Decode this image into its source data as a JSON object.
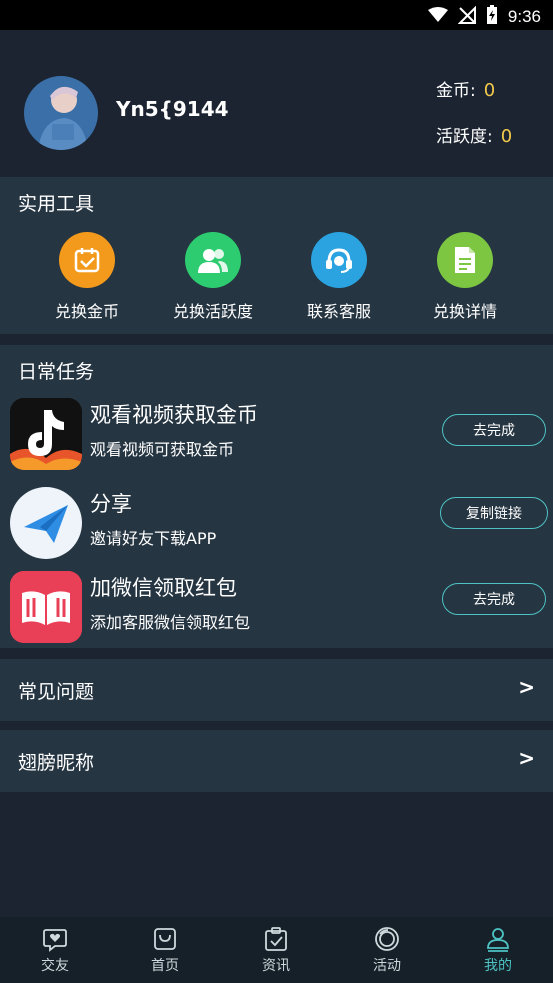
{
  "status_bar": {
    "time": "9:36"
  },
  "profile": {
    "username": "Yn5{9144",
    "coins_label": "金币:",
    "coins_value": "0",
    "activity_label": "活跃度:",
    "activity_value": "0"
  },
  "tools": {
    "title": "实用工具",
    "items": [
      {
        "label": "兑换金币",
        "icon": "calendar-check-icon",
        "color": "#f39a1c"
      },
      {
        "label": "兑换活跃度",
        "icon": "users-icon",
        "color": "#2ecc71"
      },
      {
        "label": "联系客服",
        "icon": "headset-icon",
        "color": "#2aa3e0"
      },
      {
        "label": "兑换详情",
        "icon": "document-icon",
        "color": "#7cc641"
      }
    ]
  },
  "tasks": {
    "title": "日常任务",
    "items": [
      {
        "title": "观看视频获取金币",
        "subtitle": "观看视频可获取金币",
        "button": "去完成",
        "icon": "tiktok-icon"
      },
      {
        "title": "分享",
        "subtitle": "邀请好友下载APP",
        "button": "复制链接",
        "icon": "paper-plane-icon"
      },
      {
        "title": "加微信领取红包",
        "subtitle": "添加客服微信领取红包",
        "button": "去完成",
        "icon": "book-icon"
      }
    ]
  },
  "rows": [
    {
      "label": "常见问题",
      "arrow": ">"
    },
    {
      "label": "翅膀昵称",
      "arrow": ">"
    }
  ],
  "tabbar": {
    "items": [
      {
        "label": "交友",
        "icon": "heart-chat-icon"
      },
      {
        "label": "首页",
        "icon": "bag-icon"
      },
      {
        "label": "资讯",
        "icon": "clipboard-check-icon"
      },
      {
        "label": "活动",
        "icon": "circle-ring-icon"
      },
      {
        "label": "我的",
        "icon": "person-icon"
      }
    ],
    "active_index": 4,
    "active_color": "#4ec3c4"
  }
}
